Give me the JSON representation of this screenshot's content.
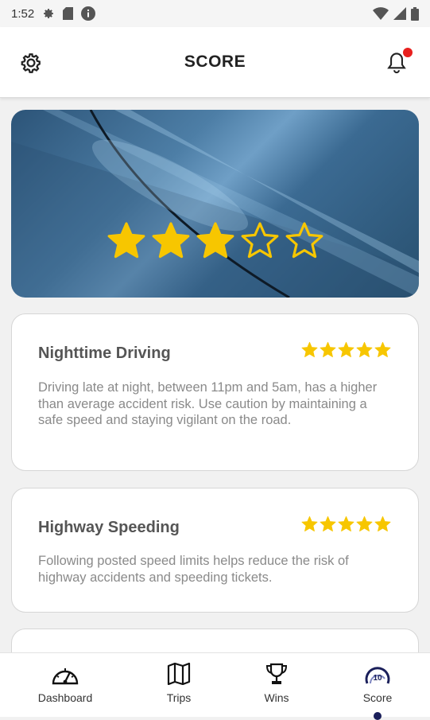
{
  "status_bar": {
    "time": "1:52"
  },
  "header": {
    "title": "SCORE"
  },
  "hero": {
    "rating": 3,
    "max_rating": 5,
    "star_color": "#f7c600"
  },
  "cards": [
    {
      "title": "Nighttime Driving",
      "rating": 5,
      "description": "Driving late at night, between 11pm and 5am, has a higher than average accident risk.  Use caution by maintaining a safe speed and staying vigilant on the road."
    },
    {
      "title": "Highway Speeding",
      "rating": 5,
      "description": "Following posted speed limits helps reduce the risk of highway accidents and speeding tickets."
    }
  ],
  "bottom_nav": {
    "items": [
      {
        "label": "Dashboard",
        "icon": "speedometer-icon"
      },
      {
        "label": "Trips",
        "icon": "map-icon"
      },
      {
        "label": "Wins",
        "icon": "trophy-icon"
      },
      {
        "label": "Score",
        "icon": "score-gauge-icon",
        "gauge_value": "10",
        "active": true
      }
    ]
  },
  "colors": {
    "accent_navy": "#1a1f5a",
    "notification": "#e8201e",
    "star": "#f7c600"
  }
}
